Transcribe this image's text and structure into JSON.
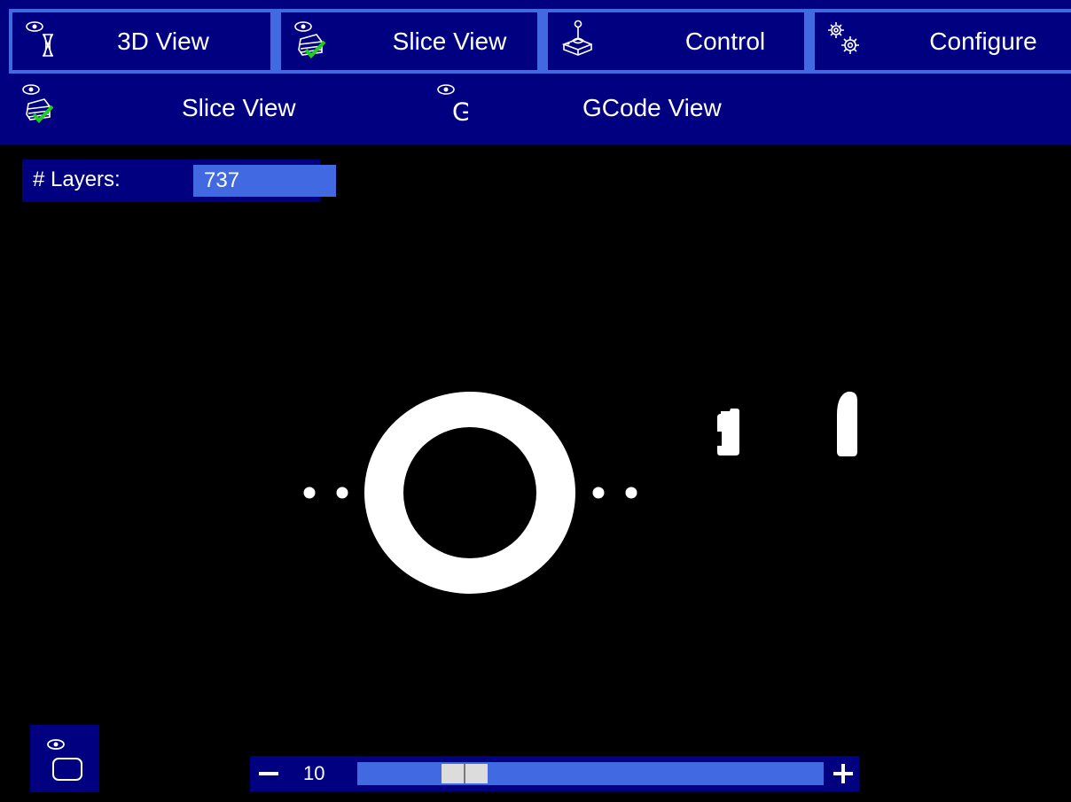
{
  "tabs": [
    {
      "label": "3D View",
      "icon": "eye-hourglass-icon"
    },
    {
      "label": "Slice View",
      "icon": "slice-check-icon",
      "selected": true
    },
    {
      "label": "Control",
      "icon": "joystick-icon"
    },
    {
      "label": "Configure",
      "icon": "gears-icon"
    }
  ],
  "subtabs": [
    {
      "label": "Slice View",
      "icon": "slice-check-icon",
      "selected": true
    },
    {
      "label": "GCode View",
      "icon": "eye-g-icon"
    }
  ],
  "layers": {
    "label": "# Layers:",
    "value": "737"
  },
  "zoom": {
    "value": "10",
    "position": 0.2
  },
  "view_toggle": {
    "icon": "eye-frame-icon"
  },
  "colors": {
    "bar": "#000080",
    "accent": "#4169e1",
    "check": "#1ed01e",
    "slice_fill": "#ffffff",
    "background": "#000000"
  }
}
